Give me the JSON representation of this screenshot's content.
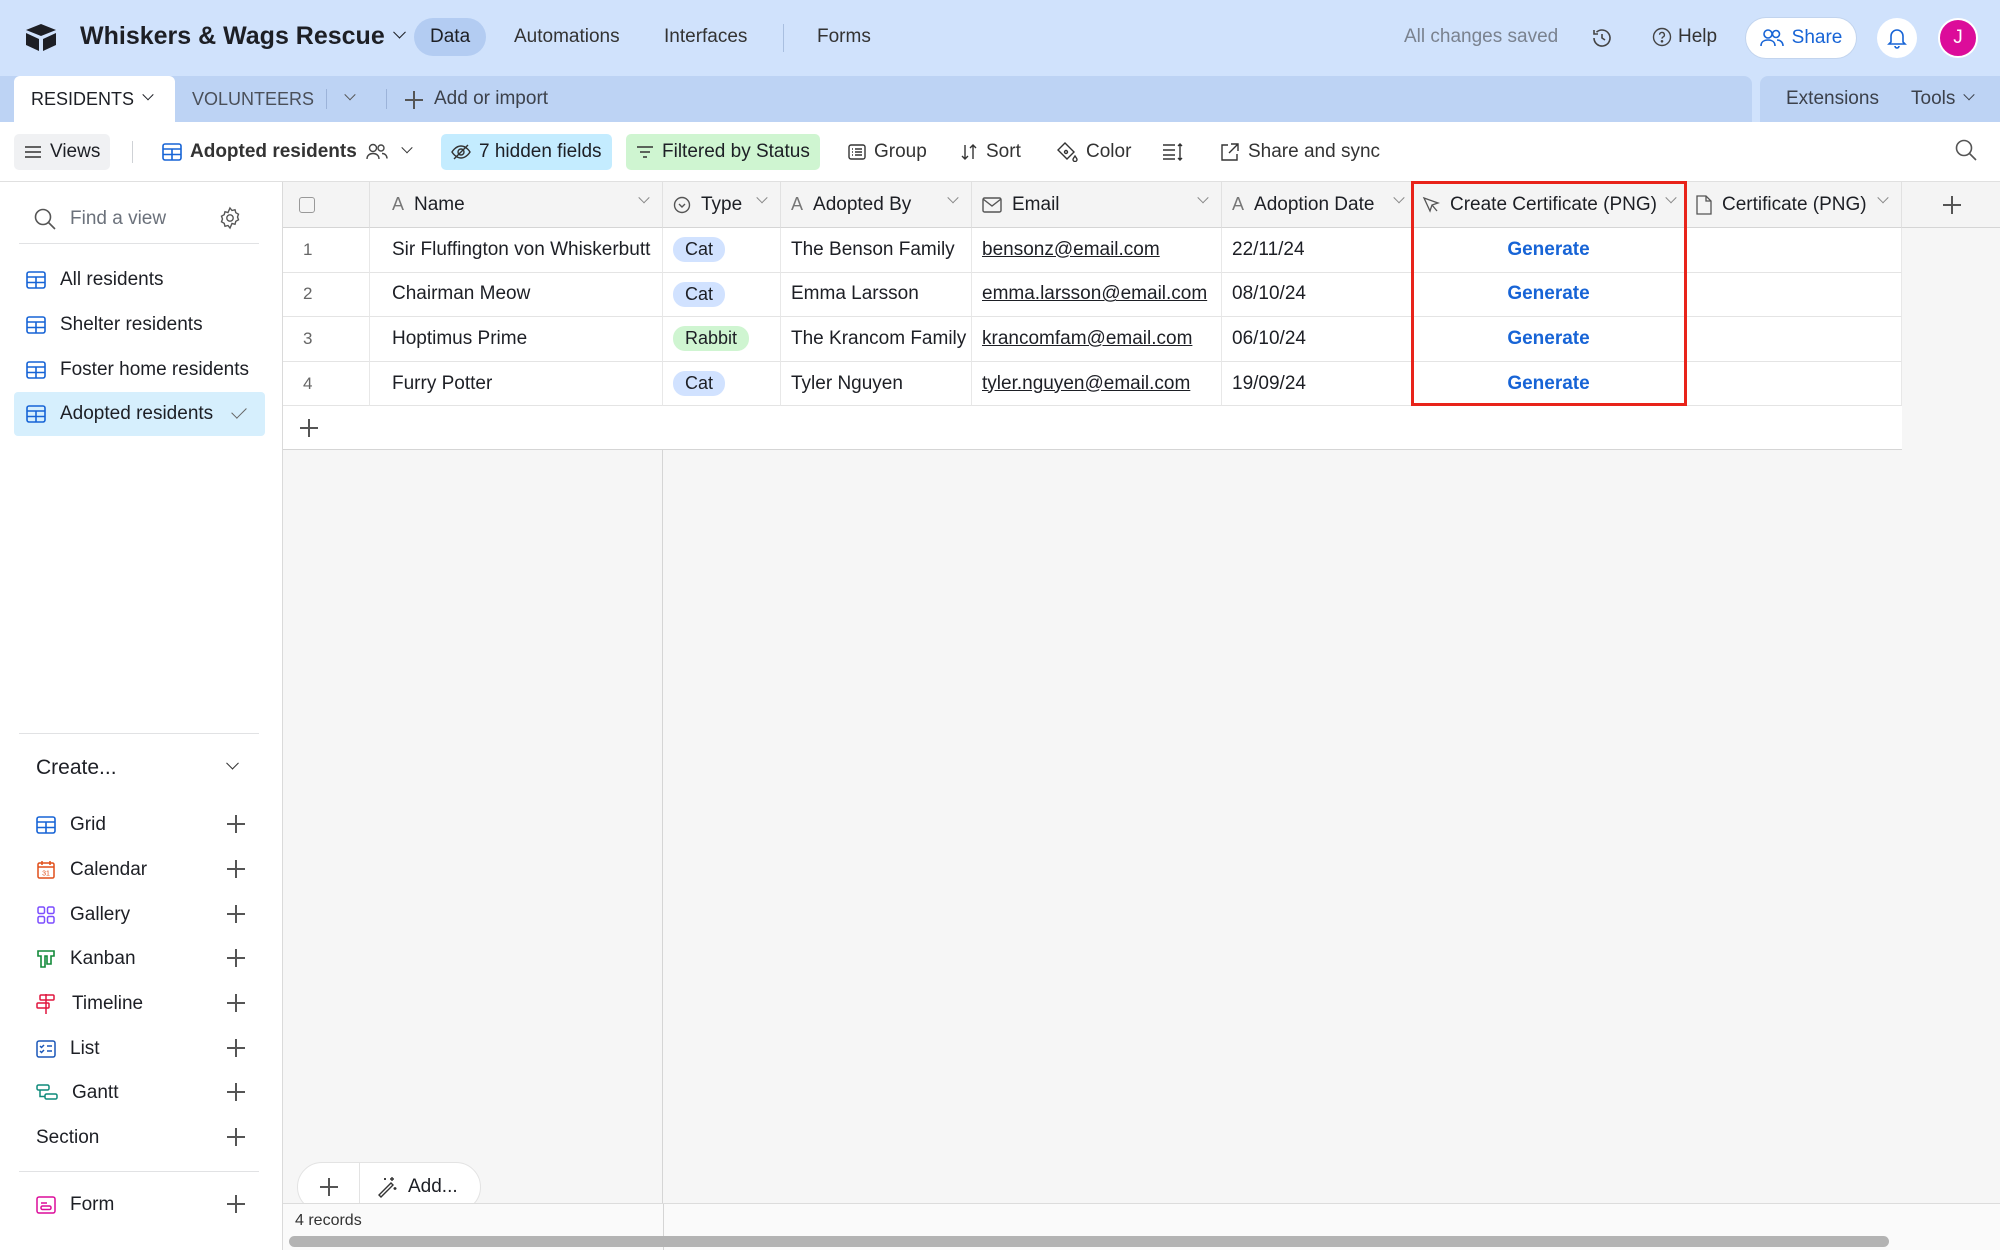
{
  "app": {
    "base_name": "Whiskers & Wags Rescue",
    "nav": [
      "Data",
      "Automations",
      "Interfaces",
      "Forms"
    ],
    "active_nav": "Data",
    "save_status": "All changes saved",
    "help_label": "Help",
    "share_label": "Share",
    "avatar_initial": "J",
    "avatar_color": "#dc0c9a"
  },
  "tabs": {
    "tables": [
      "RESIDENTS",
      "VOLUNTEERS"
    ],
    "active_table": "RESIDENTS",
    "add_import": "Add or import",
    "extensions": "Extensions",
    "tools": "Tools"
  },
  "toolbar": {
    "views": "Views",
    "current_view": "Adopted residents",
    "hidden_fields": "7 hidden fields",
    "filter": "Filtered by Status",
    "group": "Group",
    "sort": "Sort",
    "color": "Color",
    "share_sync": "Share and sync"
  },
  "sidebar": {
    "find_placeholder": "Find a view",
    "views": [
      {
        "label": "All residents",
        "active": false
      },
      {
        "label": "Shelter residents",
        "active": false
      },
      {
        "label": "Foster home residents",
        "active": false
      },
      {
        "label": "Adopted residents",
        "active": true
      }
    ],
    "create_title": "Create...",
    "create_items": [
      {
        "label": "Grid",
        "icon": "grid-icon",
        "color": "#1764d6"
      },
      {
        "label": "Calendar",
        "icon": "calendar-icon",
        "color": "#e04f1a"
      },
      {
        "label": "Gallery",
        "icon": "gallery-icon",
        "color": "#7c4dff"
      },
      {
        "label": "Kanban",
        "icon": "kanban-icon",
        "color": "#138a3a"
      },
      {
        "label": "Timeline",
        "icon": "timeline-icon",
        "color": "#e0163f"
      },
      {
        "label": "List",
        "icon": "list-icon",
        "color": "#1a57b8"
      },
      {
        "label": "Gantt",
        "icon": "gantt-icon",
        "color": "#0e8a7a"
      },
      {
        "label": "Section",
        "icon": "",
        "color": ""
      }
    ],
    "form_item": {
      "label": "Form",
      "icon": "form-icon",
      "color": "#dc0c9a"
    }
  },
  "grid": {
    "columns": [
      {
        "label": "Name",
        "icon": "text-icon"
      },
      {
        "label": "Type",
        "icon": "single-select-icon"
      },
      {
        "label": "Adopted By",
        "icon": "text-icon"
      },
      {
        "label": "Email",
        "icon": "email-icon"
      },
      {
        "label": "Adoption Date",
        "icon": "text-icon"
      },
      {
        "label": "Create Certificate (PNG)",
        "icon": "cursor-icon"
      },
      {
        "label": "Certificate (PNG)",
        "icon": "file-icon"
      }
    ],
    "rows": [
      {
        "num": "1",
        "name": "Sir Fluffington von Whiskerbutt",
        "type": "Cat",
        "adopted_by": "The Benson Family",
        "email": "bensonz@email.com",
        "date": "22/11/24",
        "button": "Generate",
        "certificate": ""
      },
      {
        "num": "2",
        "name": "Chairman Meow",
        "type": "Cat",
        "adopted_by": "Emma Larsson",
        "email": "emma.larsson@email.com",
        "date": "08/10/24",
        "button": "Generate",
        "certificate": ""
      },
      {
        "num": "3",
        "name": "Hoptimus Prime",
        "type": "Rabbit",
        "adopted_by": "The Krancom Family",
        "email": "krancomfam@email.com",
        "date": "06/10/24",
        "button": "Generate",
        "certificate": ""
      },
      {
        "num": "4",
        "name": "Furry Potter",
        "type": "Cat",
        "adopted_by": "Tyler Nguyen",
        "email": "tyler.nguyen@email.com",
        "date": "19/09/24",
        "button": "Generate",
        "certificate": ""
      }
    ],
    "type_colors": {
      "Cat": "#d1e2ff",
      "Rabbit": "#cff5d1"
    },
    "add_label": "Add...",
    "record_count": "4 records"
  }
}
